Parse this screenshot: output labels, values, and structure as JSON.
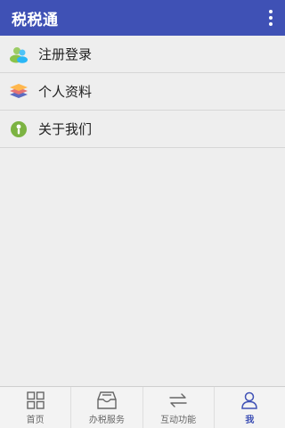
{
  "appbar": {
    "title": "税税通",
    "menu_icon": "more-vert-icon"
  },
  "menu": [
    {
      "label": "注册登录",
      "icon": "register-login-icon"
    },
    {
      "label": "个人资料",
      "icon": "profile-layers-icon"
    },
    {
      "label": "关于我们",
      "icon": "about-info-icon"
    }
  ],
  "bottom_nav": [
    {
      "label": "首页",
      "icon": "grid-home-icon",
      "active": false
    },
    {
      "label": "办税服务",
      "icon": "inbox-service-icon",
      "active": false
    },
    {
      "label": "互动功能",
      "icon": "swap-arrows-icon",
      "active": false
    },
    {
      "label": "我",
      "icon": "person-icon",
      "active": true
    }
  ],
  "colors": {
    "primary": "#3f51b5",
    "background": "#eeeeee"
  }
}
